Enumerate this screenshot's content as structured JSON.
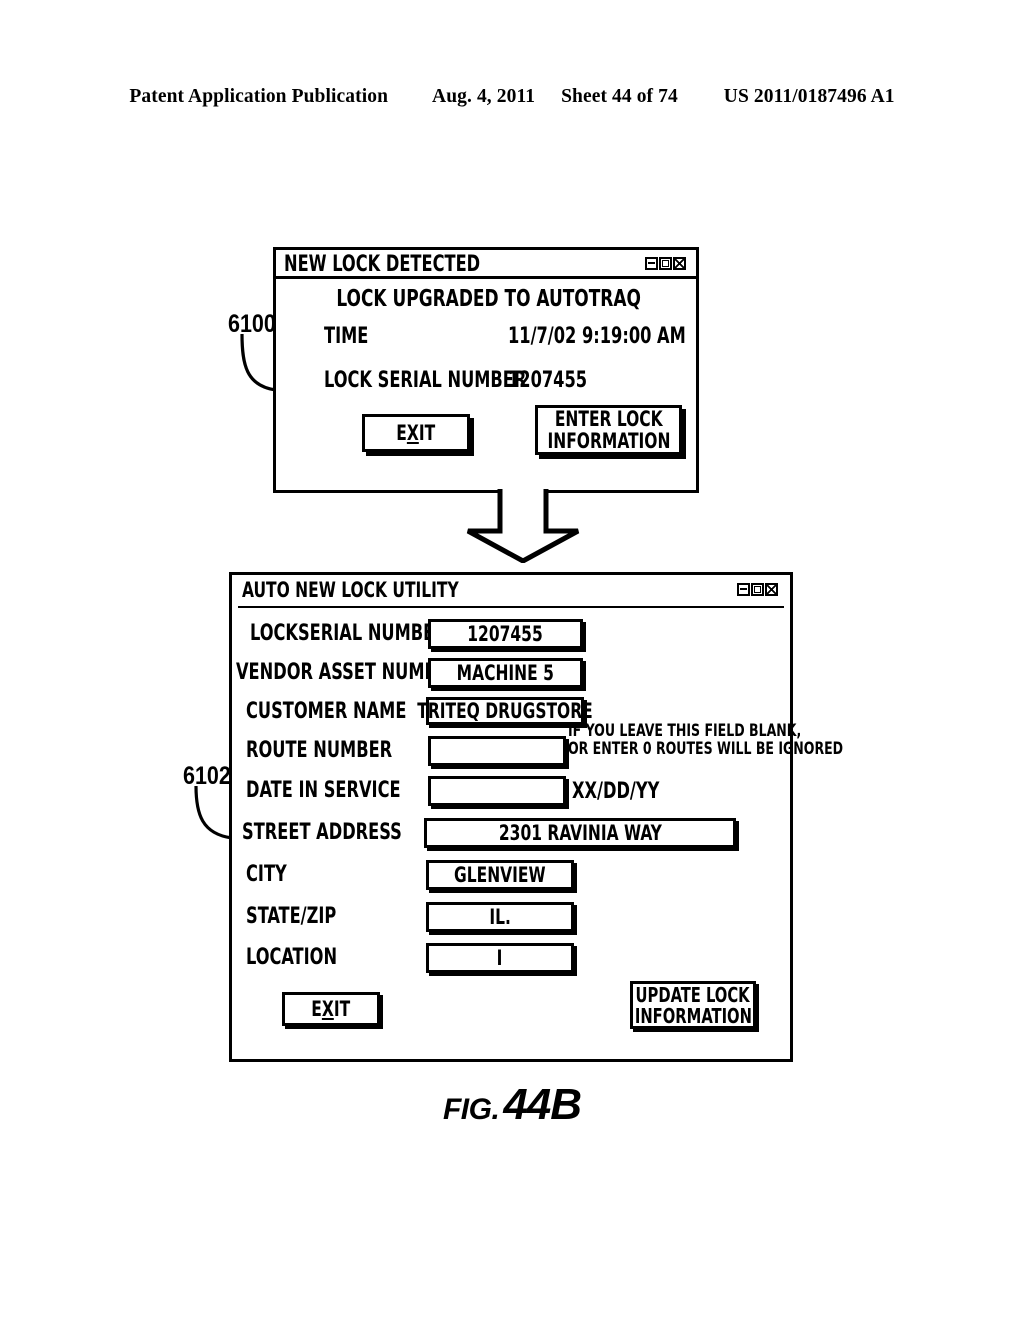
{
  "page_header": {
    "publication": "Patent Application Publication",
    "date": "Aug. 4, 2011",
    "sheet": "Sheet 44 of 74",
    "patent_number": "US 2011/0187496 A1"
  },
  "figure": {
    "label_prefix": "FIG.",
    "label_number": "44B"
  },
  "reference_numerals": {
    "dialog": "6100",
    "utility": "6102"
  },
  "window_controls": {
    "minimize": "minimize-button",
    "maximize": "maximize-button",
    "close": "close-button"
  },
  "new_lock_dialog": {
    "title": "NEW LOCK DETECTED",
    "heading": "LOCK UPGRADED TO AUTOTRAQ",
    "rows": [
      {
        "label": "TIME",
        "value": "11/7/02 9:19:00 AM"
      },
      {
        "label": "LOCK SERIAL NUMBER",
        "value": "1207455"
      }
    ],
    "buttons": {
      "exit": {
        "pre": "E",
        "accel": "X",
        "post": "IT"
      },
      "enter_lock": {
        "line1": "ENTER LOCK",
        "line2": "INFORMATION"
      }
    }
  },
  "auto_new_lock_utility": {
    "title": "AUTO NEW LOCK UTILITY",
    "fields": [
      {
        "label": "LOCKSERIAL NUMBER",
        "value": "1207455"
      },
      {
        "label": "VENDOR ASSET NUMBER",
        "value": "MACHINE 5"
      },
      {
        "label": "CUSTOMER NAME",
        "value": "TRITEQ DRUGSTORE"
      },
      {
        "label": "ROUTE NUMBER",
        "value": ""
      },
      {
        "label": "DATE IN SERVICE",
        "value": ""
      },
      {
        "label": "STREET ADDRESS",
        "value": "2301 RAVINIA WAY"
      },
      {
        "label": "CITY",
        "value": "GLENVIEW"
      },
      {
        "label": "STATE/ZIP",
        "value": "IL."
      },
      {
        "label": "LOCATION",
        "value": "I"
      }
    ],
    "route_hint_line1": "IF YOU LEAVE THIS FIELD BLANK,",
    "route_hint_line2": "OR ENTER 0 ROUTES WILL BE IGNORED",
    "date_format_hint": "XX/DD/YY",
    "buttons": {
      "exit": {
        "pre": "E",
        "accel": "X",
        "post": "IT"
      },
      "update": {
        "line1": "UPDATE LOCK",
        "line2": "INFORMATION"
      }
    }
  }
}
